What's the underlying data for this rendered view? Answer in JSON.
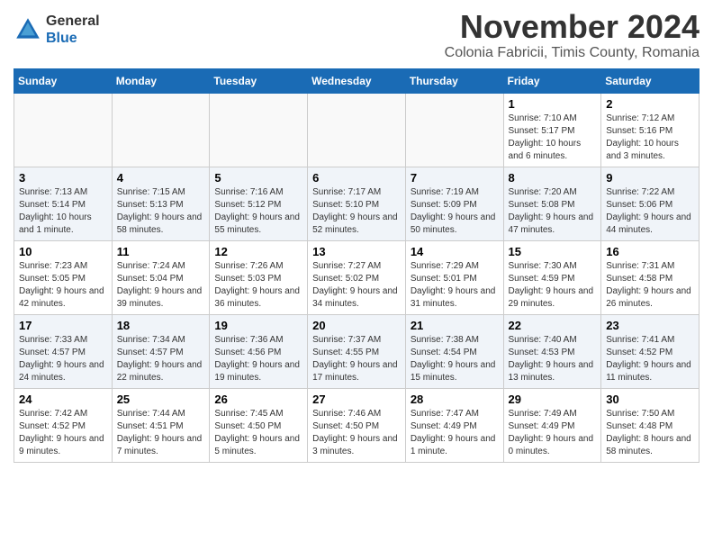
{
  "header": {
    "logo_line1": "General",
    "logo_line2": "Blue",
    "month": "November 2024",
    "location": "Colonia Fabricii, Timis County, Romania"
  },
  "weekdays": [
    "Sunday",
    "Monday",
    "Tuesday",
    "Wednesday",
    "Thursday",
    "Friday",
    "Saturday"
  ],
  "weeks": [
    [
      {
        "day": "",
        "info": ""
      },
      {
        "day": "",
        "info": ""
      },
      {
        "day": "",
        "info": ""
      },
      {
        "day": "",
        "info": ""
      },
      {
        "day": "",
        "info": ""
      },
      {
        "day": "1",
        "info": "Sunrise: 7:10 AM\nSunset: 5:17 PM\nDaylight: 10 hours and 6 minutes."
      },
      {
        "day": "2",
        "info": "Sunrise: 7:12 AM\nSunset: 5:16 PM\nDaylight: 10 hours and 3 minutes."
      }
    ],
    [
      {
        "day": "3",
        "info": "Sunrise: 7:13 AM\nSunset: 5:14 PM\nDaylight: 10 hours and 1 minute."
      },
      {
        "day": "4",
        "info": "Sunrise: 7:15 AM\nSunset: 5:13 PM\nDaylight: 9 hours and 58 minutes."
      },
      {
        "day": "5",
        "info": "Sunrise: 7:16 AM\nSunset: 5:12 PM\nDaylight: 9 hours and 55 minutes."
      },
      {
        "day": "6",
        "info": "Sunrise: 7:17 AM\nSunset: 5:10 PM\nDaylight: 9 hours and 52 minutes."
      },
      {
        "day": "7",
        "info": "Sunrise: 7:19 AM\nSunset: 5:09 PM\nDaylight: 9 hours and 50 minutes."
      },
      {
        "day": "8",
        "info": "Sunrise: 7:20 AM\nSunset: 5:08 PM\nDaylight: 9 hours and 47 minutes."
      },
      {
        "day": "9",
        "info": "Sunrise: 7:22 AM\nSunset: 5:06 PM\nDaylight: 9 hours and 44 minutes."
      }
    ],
    [
      {
        "day": "10",
        "info": "Sunrise: 7:23 AM\nSunset: 5:05 PM\nDaylight: 9 hours and 42 minutes."
      },
      {
        "day": "11",
        "info": "Sunrise: 7:24 AM\nSunset: 5:04 PM\nDaylight: 9 hours and 39 minutes."
      },
      {
        "day": "12",
        "info": "Sunrise: 7:26 AM\nSunset: 5:03 PM\nDaylight: 9 hours and 36 minutes."
      },
      {
        "day": "13",
        "info": "Sunrise: 7:27 AM\nSunset: 5:02 PM\nDaylight: 9 hours and 34 minutes."
      },
      {
        "day": "14",
        "info": "Sunrise: 7:29 AM\nSunset: 5:01 PM\nDaylight: 9 hours and 31 minutes."
      },
      {
        "day": "15",
        "info": "Sunrise: 7:30 AM\nSunset: 4:59 PM\nDaylight: 9 hours and 29 minutes."
      },
      {
        "day": "16",
        "info": "Sunrise: 7:31 AM\nSunset: 4:58 PM\nDaylight: 9 hours and 26 minutes."
      }
    ],
    [
      {
        "day": "17",
        "info": "Sunrise: 7:33 AM\nSunset: 4:57 PM\nDaylight: 9 hours and 24 minutes."
      },
      {
        "day": "18",
        "info": "Sunrise: 7:34 AM\nSunset: 4:57 PM\nDaylight: 9 hours and 22 minutes."
      },
      {
        "day": "19",
        "info": "Sunrise: 7:36 AM\nSunset: 4:56 PM\nDaylight: 9 hours and 19 minutes."
      },
      {
        "day": "20",
        "info": "Sunrise: 7:37 AM\nSunset: 4:55 PM\nDaylight: 9 hours and 17 minutes."
      },
      {
        "day": "21",
        "info": "Sunrise: 7:38 AM\nSunset: 4:54 PM\nDaylight: 9 hours and 15 minutes."
      },
      {
        "day": "22",
        "info": "Sunrise: 7:40 AM\nSunset: 4:53 PM\nDaylight: 9 hours and 13 minutes."
      },
      {
        "day": "23",
        "info": "Sunrise: 7:41 AM\nSunset: 4:52 PM\nDaylight: 9 hours and 11 minutes."
      }
    ],
    [
      {
        "day": "24",
        "info": "Sunrise: 7:42 AM\nSunset: 4:52 PM\nDaylight: 9 hours and 9 minutes."
      },
      {
        "day": "25",
        "info": "Sunrise: 7:44 AM\nSunset: 4:51 PM\nDaylight: 9 hours and 7 minutes."
      },
      {
        "day": "26",
        "info": "Sunrise: 7:45 AM\nSunset: 4:50 PM\nDaylight: 9 hours and 5 minutes."
      },
      {
        "day": "27",
        "info": "Sunrise: 7:46 AM\nSunset: 4:50 PM\nDaylight: 9 hours and 3 minutes."
      },
      {
        "day": "28",
        "info": "Sunrise: 7:47 AM\nSunset: 4:49 PM\nDaylight: 9 hours and 1 minute."
      },
      {
        "day": "29",
        "info": "Sunrise: 7:49 AM\nSunset: 4:49 PM\nDaylight: 9 hours and 0 minutes."
      },
      {
        "day": "30",
        "info": "Sunrise: 7:50 AM\nSunset: 4:48 PM\nDaylight: 8 hours and 58 minutes."
      }
    ]
  ]
}
